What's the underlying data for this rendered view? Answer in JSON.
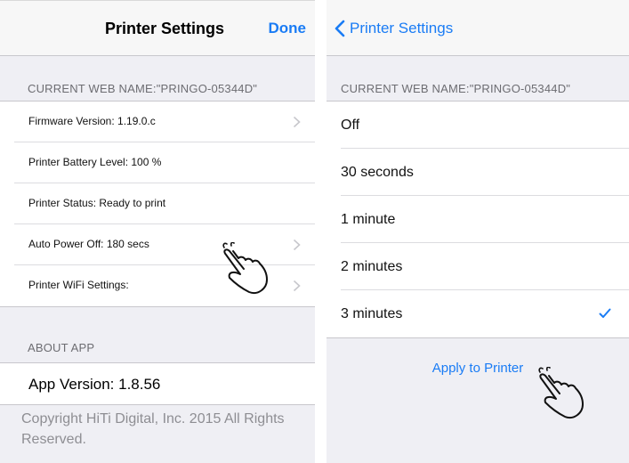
{
  "left": {
    "nav": {
      "title": "Printer Settings",
      "done_label": "Done"
    },
    "web_name_header": "CURRENT WEB NAME:\"PRINGO-05344D\"",
    "rows": [
      {
        "label": "Firmware Version: 1.19.0.c",
        "chevron": true
      },
      {
        "label": "Printer Battery Level: 100 %",
        "chevron": false
      },
      {
        "label": "Printer Status: Ready to print",
        "chevron": false
      },
      {
        "label": "Auto Power Off: 180 secs",
        "chevron": true
      },
      {
        "label": "Printer WiFi Settings:",
        "chevron": true
      }
    ],
    "about_header": "ABOUT APP",
    "app_version": "App Version: 1.8.56",
    "copyright": "Copyright HiTi Digital, Inc. 2015 All Rights Reserved."
  },
  "right": {
    "nav": {
      "back_label": "Printer Settings"
    },
    "web_name_header": "CURRENT WEB NAME:\"PRINGO-05344D\"",
    "options": [
      {
        "label": "Off",
        "selected": false
      },
      {
        "label": "30 seconds",
        "selected": false
      },
      {
        "label": "1 minute",
        "selected": false
      },
      {
        "label": "2 minutes",
        "selected": false
      },
      {
        "label": "3 minutes",
        "selected": true
      }
    ],
    "apply_label": "Apply to Printer"
  },
  "colors": {
    "accent": "#1a7cf5",
    "background": "#efeff4",
    "header_text": "#6d6d72",
    "footer_text": "#8e8e93"
  },
  "icons": [
    "chevron-right-icon",
    "chevron-left-icon",
    "checkmark-icon",
    "hand-pointer-icon"
  ]
}
